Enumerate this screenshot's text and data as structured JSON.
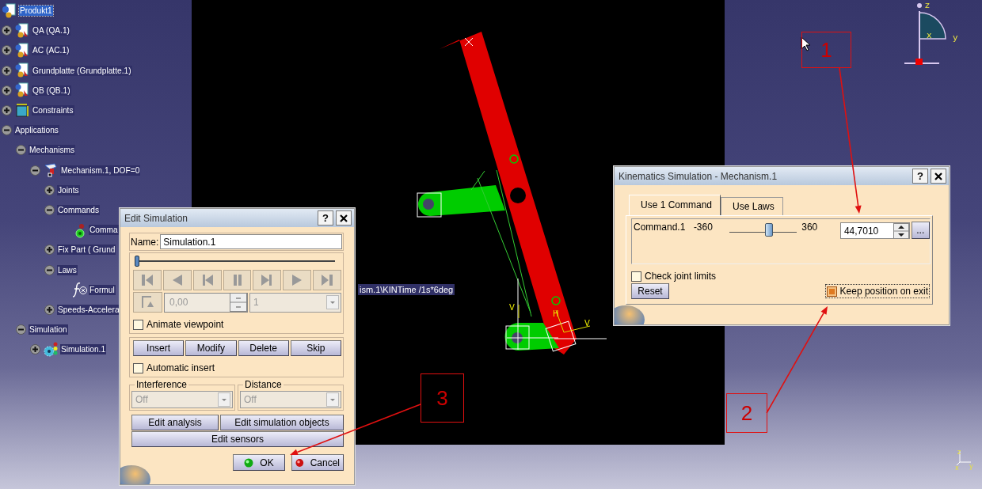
{
  "tree": {
    "items": [
      {
        "label": "Produkt1",
        "kind": "product",
        "selected": true,
        "children": [
          {
            "label": "QA (QA.1)",
            "kind": "part",
            "selected": false,
            "expanded": false
          },
          {
            "label": "AC (AC.1)",
            "kind": "part",
            "selected": false,
            "expanded": false
          },
          {
            "label": "Grundplatte (Grundplatte.1)",
            "kind": "part",
            "selected": false,
            "expanded": false
          },
          {
            "label": "QB (QB.1)",
            "kind": "part",
            "selected": false,
            "expanded": false
          },
          {
            "label": "Constraints",
            "kind": "constraints",
            "selected": false,
            "expanded": false
          },
          {
            "label": "Applications",
            "selected": false,
            "expanded": true,
            "children": [
              {
                "label": "Mechanisms",
                "selected": false,
                "expanded": true,
                "children": [
                  {
                    "label": "Mechanism.1, DOF=0",
                    "kind": "mechanism",
                    "selected": false,
                    "expanded": true,
                    "children": [
                      {
                        "label": "Joints",
                        "selected": false,
                        "expanded": false
                      },
                      {
                        "label": "Commands",
                        "selected": false,
                        "expanded": true,
                        "children": [
                          {
                            "label": "Comma",
                            "kind": "command",
                            "selected": false
                          }
                        ]
                      },
                      {
                        "label": "Fix Part ( Grund",
                        "selected": false,
                        "expanded": false
                      },
                      {
                        "label": "Laws",
                        "selected": false,
                        "expanded": true,
                        "children": [
                          {
                            "label": "Formul",
                            "kind": "formula",
                            "selected": false
                          }
                        ]
                      },
                      {
                        "label": "Speeds-Accelera",
                        "selected": false,
                        "expanded": false
                      }
                    ]
                  }
                ]
              },
              {
                "label": "Simulation",
                "selected": false,
                "expanded": true,
                "children": [
                  {
                    "label": "Simulation.1",
                    "kind": "simulation",
                    "selected": false,
                    "expanded": false
                  }
                ]
              }
            ]
          }
        ]
      }
    ],
    "overflow_text": "ism.1\\KINTime /1s*6deg"
  },
  "viewport": {
    "labels": [
      "V",
      "H",
      "V"
    ]
  },
  "compass": {
    "labels": [
      "z",
      "x",
      "y"
    ]
  },
  "axis_triad": {
    "labels": [
      "z",
      "x",
      "y"
    ]
  },
  "edit_simulation": {
    "title": "Edit Simulation",
    "help": "?",
    "name_label": "Name:",
    "name_value": "Simulation.1",
    "timeline": {
      "level": 0
    },
    "player_buttons": [
      {
        "kind": "jump-start"
      },
      {
        "kind": "play-back"
      },
      {
        "kind": "step-back"
      },
      {
        "kind": "pause"
      },
      {
        "kind": "step-forward"
      },
      {
        "kind": "play-forward"
      },
      {
        "kind": "jump-end"
      }
    ],
    "step_field": {
      "value": "0,00",
      "disabled": true
    },
    "step_dropdown": {
      "value": "1",
      "disabled": true
    },
    "animate_viewpoint": {
      "label": "Animate viewpoint",
      "checked": false
    },
    "actions": [
      "Insert",
      "Modify",
      "Delete",
      "Skip"
    ],
    "automatic_insert": {
      "label": "Automatic insert",
      "checked": false
    },
    "interference": {
      "label": "Interference",
      "value": "Off",
      "disabled": true
    },
    "distance": {
      "label": "Distance",
      "value": "Off",
      "disabled": true
    },
    "edit_buttons": [
      "Edit analysis",
      "Edit simulation objects",
      "Edit sensors"
    ],
    "ok": "OK",
    "cancel": "Cancel"
  },
  "kinematics": {
    "title": "Kinematics Simulation - Mechanism.1",
    "help": "?",
    "tabs": [
      {
        "label": "Use 1 Command",
        "selected": true
      },
      {
        "label": "Use Laws",
        "selected": false
      }
    ],
    "commands": [
      {
        "name": "Command.1",
        "min": "-360",
        "max": "360",
        "level": 0.59,
        "value": "44,7010",
        "more": "..."
      }
    ],
    "check_joint_limits": {
      "label": "Check joint limits",
      "checked": false
    },
    "reset": "Reset",
    "keep_position": {
      "label": "Keep position on exit",
      "checked": true
    }
  },
  "annotations": [
    {
      "label": "1"
    },
    {
      "label": "2"
    },
    {
      "label": "3"
    }
  ]
}
